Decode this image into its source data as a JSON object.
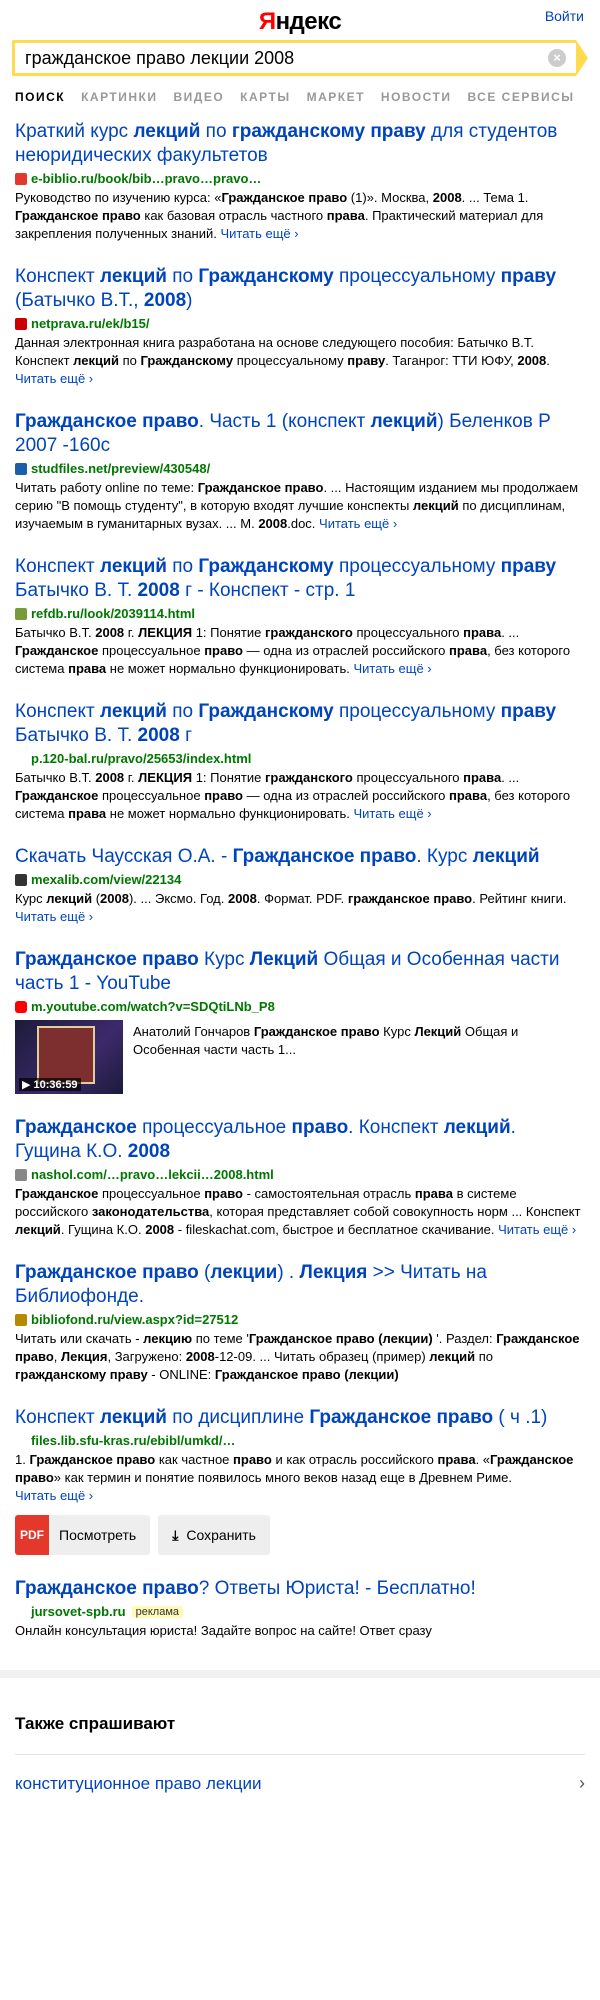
{
  "header": {
    "logo_first": "Я",
    "logo_rest": "ндекс",
    "login": "Войти"
  },
  "search": {
    "query": "гражданское право лекции 2008",
    "clear": "×"
  },
  "tabs": [
    "ПОИСК",
    "КАРТИНКИ",
    "ВИДЕО",
    "КАРТЫ",
    "МАРКЕТ",
    "НОВОСТИ",
    "ВСЕ СЕРВИСЫ"
  ],
  "more_label": "Читать ещё ›",
  "results": [
    {
      "title": [
        [
          "Краткий курс ",
          0
        ],
        [
          "лекций",
          1
        ],
        [
          " по ",
          0
        ],
        [
          "гражданскому праву",
          1
        ],
        [
          " для студентов неюридических факультетов",
          0
        ]
      ],
      "url": "e-biblio.ru/book/bib…pravo…pravo…",
      "fav_color": "#e3382b",
      "snippet": [
        [
          "Руководство по изучению курса: «",
          0
        ],
        [
          "Гражданское право",
          1
        ],
        [
          " (1)». Москва, ",
          0
        ],
        [
          "2008",
          1
        ],
        [
          ". ... Тема 1. ",
          0
        ],
        [
          "Гражданское право",
          1
        ],
        [
          " как базовая отрасль частного ",
          0
        ],
        [
          "права",
          1
        ],
        [
          ". Практический материал для закрепления полученных знаний.",
          0
        ]
      ],
      "more": true
    },
    {
      "title": [
        [
          "Конспект ",
          0
        ],
        [
          "лекций",
          1
        ],
        [
          " по ",
          0
        ],
        [
          "Гражданскому",
          1
        ],
        [
          " процессуальному ",
          0
        ],
        [
          "праву",
          1
        ],
        [
          " (Батычко В.Т., ",
          0
        ],
        [
          "2008",
          1
        ],
        [
          ")",
          0
        ]
      ],
      "url": "netprava.ru/ek/b15/",
      "fav_color": "#cc0000",
      "snippet": [
        [
          "Данная электронная книга разработана на основе следующего пособия: Батычко В.Т. Конспект ",
          0
        ],
        [
          "лекций",
          1
        ],
        [
          " по ",
          0
        ],
        [
          "Гражданскому",
          1
        ],
        [
          " процессуальному ",
          0
        ],
        [
          "праву",
          1
        ],
        [
          ". Таганрог: ТТИ ЮФУ, ",
          0
        ],
        [
          "2008",
          1
        ],
        [
          ".",
          0
        ]
      ],
      "more": true
    },
    {
      "title": [
        [
          "Гражданское право",
          1
        ],
        [
          ". Часть 1 (конспект ",
          0
        ],
        [
          "лекций",
          1
        ],
        [
          ") Беленков Р 2007 -160с",
          0
        ]
      ],
      "url": "studfiles.net/preview/430548/",
      "fav_color": "#1a5fa8",
      "snippet": [
        [
          "Читать работу online по теме: ",
          0
        ],
        [
          "Гражданское право",
          1
        ],
        [
          ". ... Настоящим изданием мы продолжаем серию \"В помощь студенту\", в которую входят лучшие конспекты ",
          0
        ],
        [
          "лекций",
          1
        ],
        [
          " по дисциплинам, изучаемым в гуманитарных вузах. ... М. ",
          0
        ],
        [
          "2008",
          1
        ],
        [
          ".doc.",
          0
        ]
      ],
      "more": true
    },
    {
      "title": [
        [
          "Конспект ",
          0
        ],
        [
          "лекций",
          1
        ],
        [
          " по ",
          0
        ],
        [
          "Гражданскому",
          1
        ],
        [
          " процессуальному ",
          0
        ],
        [
          "праву",
          1
        ],
        [
          " Батычко В. Т. ",
          0
        ],
        [
          "2008",
          1
        ],
        [
          " г - Конспект - стр. 1",
          0
        ]
      ],
      "url": "refdb.ru/look/2039114.html",
      "fav_color": "#7a9a3a",
      "snippet": [
        [
          "Батычко В.Т. ",
          0
        ],
        [
          "2008",
          1
        ],
        [
          " г. ",
          0
        ],
        [
          "ЛЕКЦИЯ",
          1
        ],
        [
          " 1: Понятие ",
          0
        ],
        [
          "гражданского",
          1
        ],
        [
          " процессуального ",
          0
        ],
        [
          "права",
          1
        ],
        [
          ". ... ",
          0
        ],
        [
          "Гражданское",
          1
        ],
        [
          " процессуальное ",
          0
        ],
        [
          "право",
          1
        ],
        [
          " — одна из отраслей российского ",
          0
        ],
        [
          "права",
          1
        ],
        [
          ", без которого система ",
          0
        ],
        [
          "права",
          1
        ],
        [
          " не может нормально функционировать.",
          0
        ]
      ],
      "more": true
    },
    {
      "title": [
        [
          "Конспект ",
          0
        ],
        [
          "лекций",
          1
        ],
        [
          " по ",
          0
        ],
        [
          "Гражданскому",
          1
        ],
        [
          " процессуальному ",
          0
        ],
        [
          "праву",
          1
        ],
        [
          " Батычко В. Т. ",
          0
        ],
        [
          "2008",
          1
        ],
        [
          " г",
          0
        ]
      ],
      "url": "p.120-bal.ru/pravo/25653/index.html",
      "fav_color": "",
      "snippet": [
        [
          "Батычко В.Т. ",
          0
        ],
        [
          "2008",
          1
        ],
        [
          " г. ",
          0
        ],
        [
          "ЛЕКЦИЯ",
          1
        ],
        [
          " 1: Понятие ",
          0
        ],
        [
          "гражданского",
          1
        ],
        [
          " процессуального ",
          0
        ],
        [
          "права",
          1
        ],
        [
          ". ... ",
          0
        ],
        [
          "Гражданское",
          1
        ],
        [
          " процессуальное ",
          0
        ],
        [
          "право",
          1
        ],
        [
          " — одна из отраслей российского ",
          0
        ],
        [
          "права",
          1
        ],
        [
          ", без которого система ",
          0
        ],
        [
          "права",
          1
        ],
        [
          " не может нормально функционировать.",
          0
        ]
      ],
      "more": true
    },
    {
      "title": [
        [
          "Скачать Чаусская О.А. - ",
          0
        ],
        [
          "Гражданское право",
          1
        ],
        [
          ". Курс ",
          0
        ],
        [
          "лекций",
          1
        ]
      ],
      "url": "mexalib.com/view/22134",
      "fav_color": "#333333",
      "snippet": [
        [
          "Курс ",
          0
        ],
        [
          "лекций",
          1
        ],
        [
          " (",
          0
        ],
        [
          "2008",
          1
        ],
        [
          "). ... Эксмо. Год. ",
          0
        ],
        [
          "2008",
          1
        ],
        [
          ". Формат. PDF. ",
          0
        ],
        [
          "гражданское право",
          1
        ],
        [
          ". Рейтинг книги.",
          0
        ]
      ],
      "more": true
    }
  ],
  "video_result": {
    "title": [
      [
        "Гражданское право",
        1
      ],
      [
        " Курс ",
        0
      ],
      [
        "Лекций",
        1
      ],
      [
        " Общая и Особенная части часть 1 - YouTube",
        0
      ]
    ],
    "url": "m.youtube.com/watch?v=SDQtiLNb_P8",
    "fav_color": "#ff0000",
    "duration": "10:36:59",
    "snippet": [
      [
        "Анатолий Гончаров ",
        0
      ],
      [
        "Гражданское право",
        1
      ],
      [
        " Курс ",
        0
      ],
      [
        "Лекций",
        1
      ],
      [
        " Общая и Особенная части часть 1...",
        0
      ]
    ]
  },
  "results2": [
    {
      "title": [
        [
          "Гражданское",
          1
        ],
        [
          " процессуальное ",
          0
        ],
        [
          "право",
          1
        ],
        [
          ". Конспект ",
          0
        ],
        [
          "лекций",
          1
        ],
        [
          ". Гущина К.О. ",
          0
        ],
        [
          "2008",
          1
        ]
      ],
      "url": "nashol.com/…pravo…lekcii…2008.html",
      "fav_color": "#888888",
      "snippet": [
        [
          "Гражданское",
          1
        ],
        [
          " процессуальное ",
          0
        ],
        [
          "право",
          1
        ],
        [
          " - самостоятельная отрасль ",
          0
        ],
        [
          "права",
          1
        ],
        [
          " в системе российского ",
          0
        ],
        [
          "законодательства",
          1
        ],
        [
          ", которая представляет собой совокупность норм ... Конспект ",
          0
        ],
        [
          "лекций",
          1
        ],
        [
          ". Гущина К.О. ",
          0
        ],
        [
          "2008",
          1
        ],
        [
          " - fileskachat.com, быстрое и бесплатное скачивание.",
          0
        ]
      ],
      "more": true
    },
    {
      "title": [
        [
          "Гражданское право",
          1
        ],
        [
          " (",
          0
        ],
        [
          "лекции",
          1
        ],
        [
          ") . ",
          0
        ],
        [
          "Лекция",
          1
        ],
        [
          " >> Читать на Библиофонде.",
          0
        ]
      ],
      "url": "bibliofond.ru/view.aspx?id=27512",
      "fav_color": "#b58a00",
      "snippet": [
        [
          "Читать или скачать - ",
          0
        ],
        [
          "лекцию",
          1
        ],
        [
          " по теме '",
          0
        ],
        [
          "Гражданское право (лекции)",
          1
        ],
        [
          " '. Раздел: ",
          0
        ],
        [
          "Гражданское право",
          1
        ],
        [
          ", ",
          0
        ],
        [
          "Лекция",
          1
        ],
        [
          ", Загружено: ",
          0
        ],
        [
          "2008",
          1
        ],
        [
          "-12-09. ... Читать образец (пример) ",
          0
        ],
        [
          "лекций",
          1
        ],
        [
          " по ",
          0
        ],
        [
          "гражданскому праву",
          1
        ],
        [
          " - ONLINE: ",
          0
        ],
        [
          "Гражданское право (лекции)",
          1
        ]
      ],
      "more": false
    },
    {
      "title": [
        [
          "Конспект ",
          0
        ],
        [
          "лекций",
          1
        ],
        [
          " по дисциплине ",
          0
        ],
        [
          "Гражданское право",
          1
        ],
        [
          " ( ч .1)",
          0
        ]
      ],
      "url": "files.lib.sfu-kras.ru/ebibl/umkd/…",
      "fav_color": "",
      "snippet": [
        [
          "1. ",
          0
        ],
        [
          "Гражданское право",
          1
        ],
        [
          " как частное ",
          0
        ],
        [
          "право",
          1
        ],
        [
          " и как отрасль российского ",
          0
        ],
        [
          "права",
          1
        ],
        [
          ". «",
          0
        ],
        [
          "Гражданское право",
          1
        ],
        [
          "» как термин и понятие появилось много веков назад еще в Древнем Риме.",
          0
        ]
      ],
      "more": true,
      "buttons": {
        "pdf": "PDF",
        "view": "Посмотреть",
        "save": "Сохранить"
      }
    },
    {
      "title": [
        [
          "Гражданское право",
          1
        ],
        [
          "? Ответы Юриста! - Бесплатно!",
          0
        ]
      ],
      "url": "jursovet-spb.ru",
      "fav_color": "",
      "ad": "реклама",
      "snippet": [
        [
          "Онлайн консультация юриста! Задайте вопрос на сайте! Ответ сразу",
          0
        ]
      ],
      "more": false
    }
  ],
  "also": {
    "heading": "Также спрашивают",
    "items": [
      {
        "label": "конституционное право лекции",
        "chev": "›"
      }
    ]
  }
}
